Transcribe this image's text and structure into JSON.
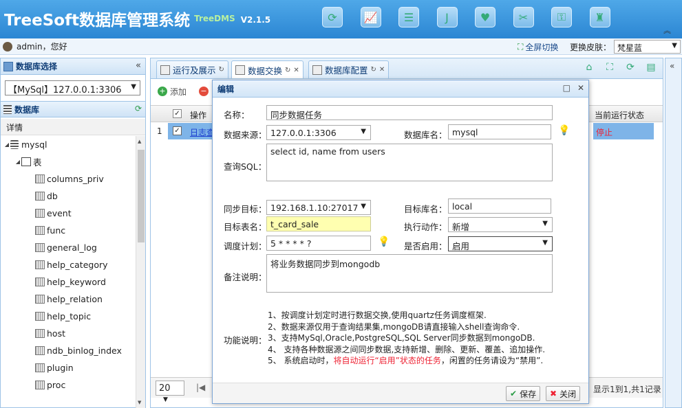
{
  "header": {
    "title": "TreeSoft数据库管理系统",
    "subtitle": "TreeDMS",
    "version": "V2.1.5",
    "icons": [
      "refresh-icon",
      "chart-icon",
      "database-icon",
      "java-icon",
      "heart-icon",
      "tools-icon",
      "key-icon",
      "user-icon"
    ],
    "collapse": "︽"
  },
  "userbar": {
    "greeting": "admin，您好",
    "fullscreen": "全屏切换",
    "skin_label": "更换皮肤：",
    "skin_value": "梵星蓝"
  },
  "left": {
    "db_select_title": "数据库选择",
    "db_select_value": "【MySql】127.0.0.1:3306",
    "db_title": "数据库",
    "detail_label": "详情",
    "tree": {
      "root": "mysql",
      "folder": "表",
      "tables": [
        "columns_priv",
        "db",
        "event",
        "func",
        "general_log",
        "help_category",
        "help_keyword",
        "help_relation",
        "help_topic",
        "host",
        "ndb_binlog_index",
        "plugin",
        "proc"
      ]
    }
  },
  "tabs": [
    {
      "label": "运行及展示"
    },
    {
      "label": "数据交换"
    },
    {
      "label": "数据库配置"
    }
  ],
  "toolbar": {
    "add": "添加"
  },
  "grid": {
    "col_op": "操作",
    "col_status": "当前运行状态",
    "row": {
      "num": "1",
      "link": "日志查",
      "status": "停止"
    },
    "page_size": "20",
    "info": "显示1到1,共1记录"
  },
  "dialog": {
    "title": "编辑",
    "name_label": "名称：",
    "name_value": "同步数据任务",
    "source_label": "数据来源：",
    "source_value": "127.0.0.1:3306",
    "dbname_label": "数据库名：",
    "dbname_value": "mysql",
    "sql_label": "查询SQL：",
    "sql_value": "select id, name from users",
    "target_label": "同步目标：",
    "target_value": "192.168.1.10:27017",
    "target_db_label": "目标库名：",
    "target_db_value": "local",
    "target_table_label": "目标表名：",
    "target_table_value": "t_card_sale",
    "action_label": "执行动作：",
    "action_value": "新增",
    "schedule_label": "调度计划：",
    "schedule_value": "5 * * * * ?",
    "enabled_label": "是否启用：",
    "enabled_value": "启用",
    "remark_label": "备注说明：",
    "remark_value": "将业务数据同步到mongodb",
    "func_label": "功能说明：",
    "func_lines": [
      "1、按调度计划定时进行数据交换,使用quartz任务调度框架.",
      "2、数据来源仅用于查询结果集,mongoDB请直接输入shell查询命令.",
      "3、支持MySql,Oracle,PostgreSQL,SQL Server同步数据到mongoDB.",
      "4、 支持各种数据源之间同步数据,支持新增、删除、更新、覆盖、追加操作.",
      "5、 系统启动时，"
    ],
    "func_red": "将自动运行“启用”状态的任务",
    "func_tail": "，闲置的任务请设为“禁用”.",
    "save": "保存",
    "close": "关闭"
  }
}
